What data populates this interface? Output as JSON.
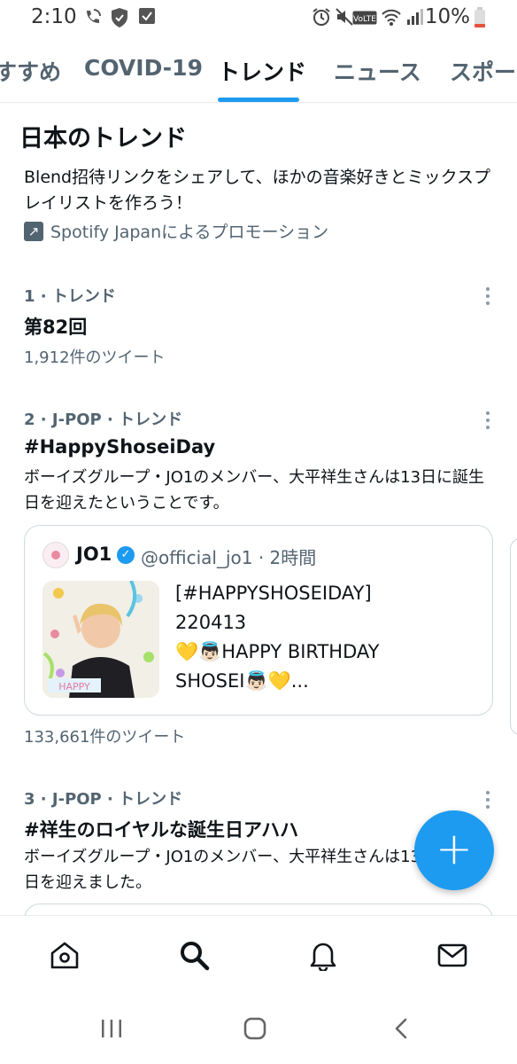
{
  "status_bar": {
    "time": "2:10",
    "battery": "10%",
    "left_icons": [
      "wifi-calling-icon",
      "shield-icon",
      "checkbox-icon"
    ],
    "right_icons": [
      "alarm-icon",
      "mute-icon",
      "volte-icon",
      "wifi-icon",
      "signal-icon",
      "battery-icon"
    ]
  },
  "tabs": [
    {
      "label": "すすめ"
    },
    {
      "label": "COVID-19"
    },
    {
      "label": "トレンド",
      "active": true
    },
    {
      "label": "ニュース"
    },
    {
      "label": "スポーツ"
    }
  ],
  "section": {
    "title": "日本のトレンド",
    "promo_text": "Blend招待リンクをシェアして、ほかの音楽好きとミックスプレイリストを作ろう！",
    "promo_by": "Spotify Japanによるプロモーション"
  },
  "trends": [
    {
      "meta": "1 · トレンド",
      "title": "第82回",
      "count": "1,912件のツイート"
    },
    {
      "meta": "2 · J-POP · トレンド",
      "title": "#HappyShoseiDay",
      "desc": "ボーイズグループ・JO1のメンバー、大平祥生さんは13日に誕生日を迎えたということです。",
      "count": "133,661件のツイート",
      "tweet": {
        "name": "JO1",
        "handle": "@official_jo1 · 2時間",
        "lines": [
          "[#HAPPYSHOSEIDAY]",
          "220413",
          "💛👼🏻HAPPY BIRTHDAY",
          "SHOSEI👼🏻💛..."
        ]
      }
    },
    {
      "meta": "3 · J-POP · トレンド",
      "title": "#祥生のロイヤルな誕生日アハハ",
      "desc": "ボーイズグループ・JO1のメンバー、大平祥生さんは13日に誕生日を迎えました。"
    }
  ],
  "fab_label": "+",
  "accent_color": "#1d9bf0",
  "bottom_nav": [
    "home-icon",
    "search-icon",
    "notifications-icon",
    "messages-icon"
  ],
  "system_nav": [
    "recents-icon",
    "home-circle-icon",
    "back-icon"
  ]
}
